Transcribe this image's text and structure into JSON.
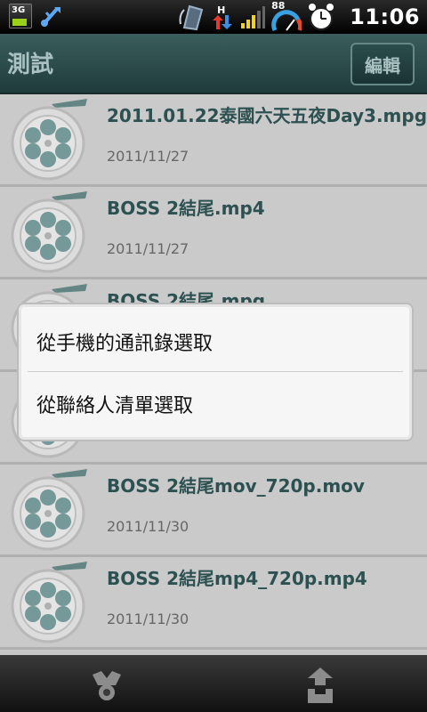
{
  "status_bar": {
    "network_type": "3G",
    "data_indicator": "H",
    "battery_level": "88",
    "time": "11:06",
    "icons": [
      "3g-signal-icon",
      "usb-icon",
      "network-activity-icon",
      "data-arrows-icon",
      "signal-bars-icon",
      "battery-gauge-icon",
      "alarm-clock-icon"
    ]
  },
  "title_bar": {
    "title": "測試",
    "edit_label": "編輯"
  },
  "files": [
    {
      "name": "2011.01.22泰國六天五夜Day3.mpg",
      "date": "2011/11/27"
    },
    {
      "name": "BOSS 2結尾.mp4",
      "date": "2011/11/27"
    },
    {
      "name": "BOSS 2結尾.mpg",
      "date": ""
    },
    {
      "name": "",
      "date": ""
    },
    {
      "name": "BOSS 2結尾mov_720p.mov",
      "date": "2011/11/30"
    },
    {
      "name": "BOSS 2結尾mp4_720p.mp4",
      "date": "2011/11/30"
    }
  ],
  "dialog": {
    "option_phone_contacts": "從手機的通訊錄選取",
    "option_contact_list": "從聯絡人清單選取"
  },
  "bottom_bar": {
    "icons": [
      "share-icon",
      "upload-icon"
    ]
  }
}
